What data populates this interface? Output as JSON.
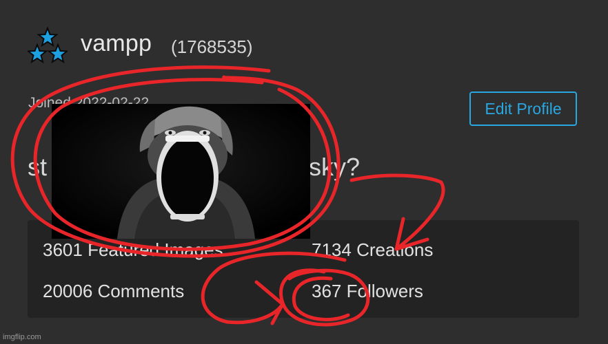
{
  "profile": {
    "username": "vampp",
    "user_id": "(1768535)",
    "joined": "Joined 2022-02-22",
    "bio_start": "st",
    "bio_end": "sky?",
    "badge_icon": "three-blue-stars-icon"
  },
  "actions": {
    "edit_profile": "Edit Profile"
  },
  "stats": {
    "featured_images": "3601 Featured Images",
    "creations": "7134 Creations",
    "comments": "20006 Comments",
    "followers": "367 Followers"
  },
  "overlay": {
    "image": "screaming-person-photo",
    "annotation_color": "#e8262a"
  },
  "watermark": "imgflip.com",
  "colors": {
    "background": "#2e2e2e",
    "panel": "#232323",
    "accent": "#29a7e0",
    "star": "#1e9fe0"
  }
}
